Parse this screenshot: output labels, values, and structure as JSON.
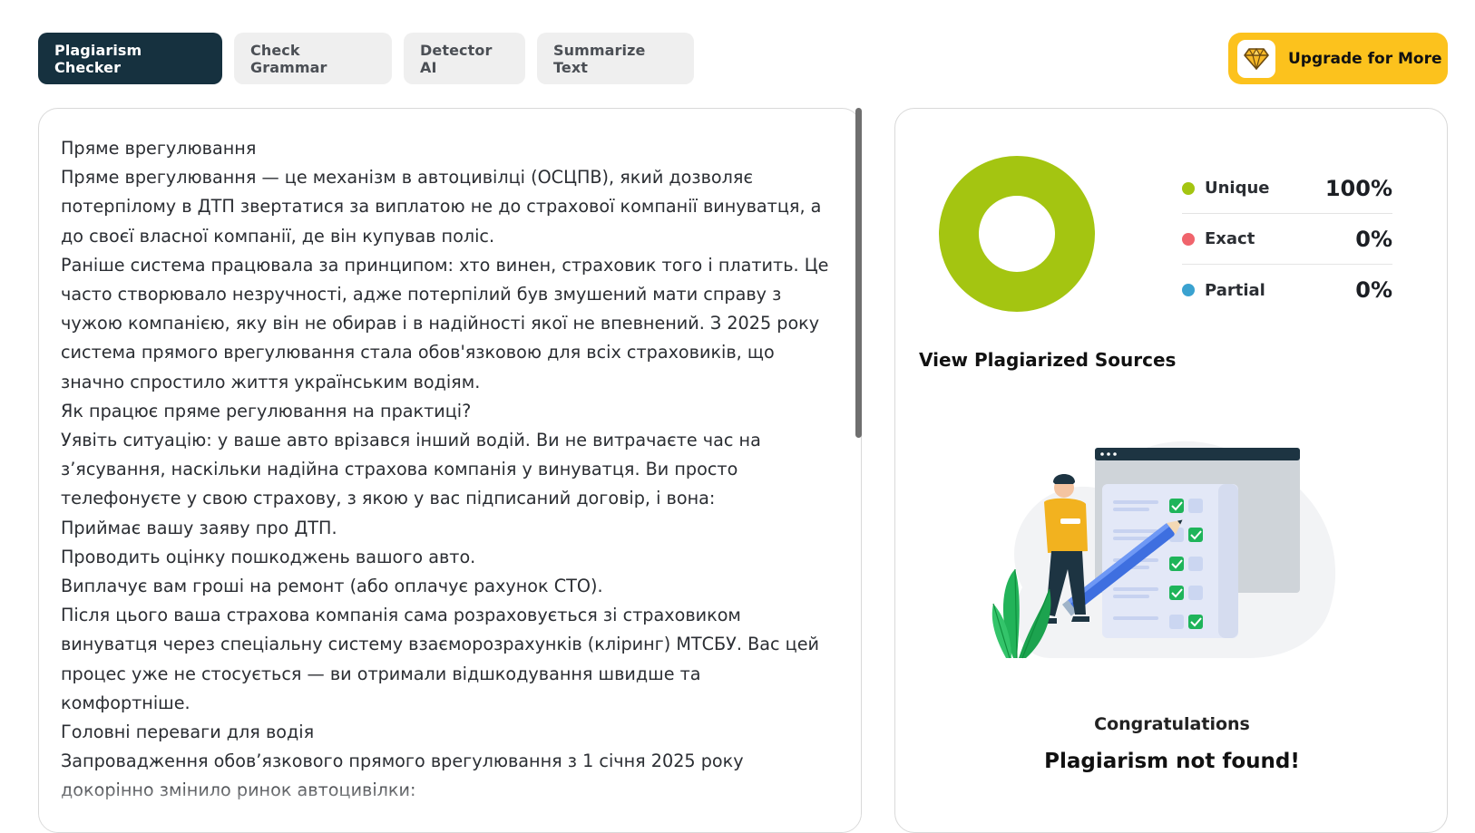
{
  "tabs": [
    {
      "label": "Plagiarism Checker",
      "active": true
    },
    {
      "label": "Check Grammar",
      "active": false
    },
    {
      "label": "Detector AI",
      "active": false
    },
    {
      "label": "Summarize Text",
      "active": false
    }
  ],
  "upgrade": {
    "label": "Upgrade for More",
    "icon": "diamond-icon"
  },
  "editor": {
    "paragraphs": [
      "Пряме врегулювання",
      "Пряме врегулювання — це механізм в автоцивілці (ОСЦПВ), який дозволяє потерпілому в ДТП звертатися за виплатою не до страхової компанії винуватця, а до своєї власної компанії, де він купував поліс.",
      "Раніше система працювала за принципом: хто винен, страховик того і платить. Це часто створювало незручності, адже потерпілий був змушений мати справу з чужою компанією, яку він не обирав і в надійності якої не впевнений. З 2025 року система прямого врегулювання стала обов'язковою для всіх страховиків, що значно спростило життя українським водіям.",
      "Як працює пряме регулювання на практиці?",
      "Уявіть ситуацію: у ваше авто врізався інший водій. Ви не витрачаєте час на з’ясування, наскільки надійна страхова компанія у винуватця. Ви просто телефонуєте у свою страхову, з якою у вас підписаний договір, і вона:",
      "Приймає вашу заяву про ДТП.",
      "Проводить оцінку пошкоджень вашого авто.",
      "Виплачує вам гроші на ремонт (або оплачує рахунок СТО).",
      "Після цього ваша страхова компанія сама розраховується зі страховиком винуватця через спеціальну систему взаєморозрахунків (кліринг) МТСБУ. Вас цей процес уже не стосується — ви отримали відшкодування швидше та комфортніше.",
      "Головні переваги для водія",
      "Запровадження обов’язкового прямого врегулювання з 1 січня 2025 року докорінно змінило ринок автоцивілки:"
    ]
  },
  "results": {
    "legend": [
      {
        "label": "Unique",
        "value": "100%",
        "color": "#a4c511"
      },
      {
        "label": "Exact",
        "value": "0%",
        "color": "#f0646c"
      },
      {
        "label": "Partial",
        "value": "0%",
        "color": "#3aa2d0"
      }
    ],
    "chart_data": {
      "type": "pie",
      "categories": [
        "Unique",
        "Exact",
        "Partial"
      ],
      "values": [
        100,
        0,
        0
      ],
      "colors": [
        "#a4c511",
        "#f0646c",
        "#3aa2d0"
      ]
    },
    "sources_title": "View Plagiarized Sources",
    "congrats": "Congratulations",
    "message": "Plagiarism not found!"
  }
}
